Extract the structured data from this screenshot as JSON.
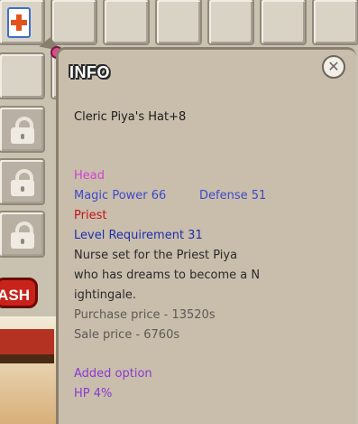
{
  "tooltip": {
    "title": "INFO",
    "item_name": "Cleric Piya's Hat+8",
    "slot": "Head",
    "magic_power": "Magic Power 66",
    "defense": "Defense 51",
    "class": "Priest",
    "level_requirement": "Level Requirement 31",
    "description": [
      "Nurse set for the Priest Piya",
      " who has dreams to become a N",
      "ightingale."
    ],
    "purchase_price": "Purchase price - 13520s",
    "sale_price": "Sale price - 6760s",
    "added_option_label": "Added option",
    "added_option_value": "HP 4%"
  },
  "side_button": {
    "label": "ASH"
  },
  "colors": {
    "slot_pink": "#d043d3",
    "stat_blue": "#3f49c8",
    "class_red": "#c2151b",
    "level_navy": "#1f2faf",
    "option_purple": "#8a3ad0"
  },
  "icons": [
    "health-potion-icon",
    "toast-item-icon",
    "lock-icon",
    "close-icon"
  ]
}
